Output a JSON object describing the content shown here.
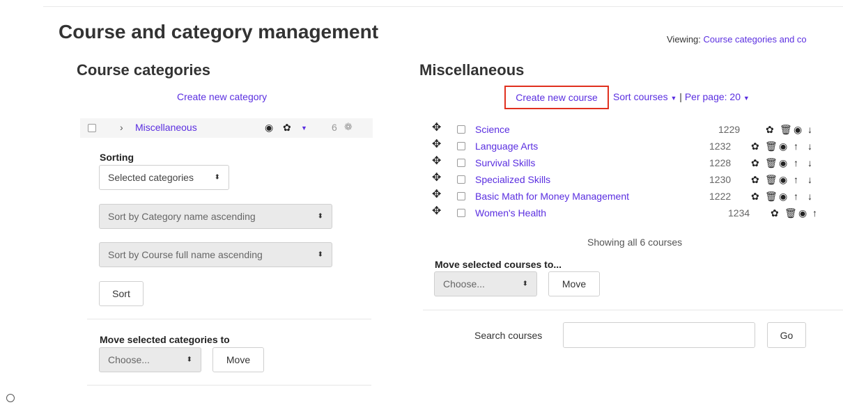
{
  "page": {
    "title": "Course and category management",
    "viewing_prefix": "Viewing: ",
    "viewing_link": "Course categories and co"
  },
  "categories": {
    "heading": "Course categories",
    "create_link": "Create new category",
    "row": {
      "name": "Miscellaneous",
      "count": "6"
    },
    "sorting": {
      "label": "Sorting",
      "scope_select": "Selected categories",
      "category_sort_select": "Sort by Category name ascending",
      "course_sort_select": "Sort by Course full name ascending",
      "sort_button": "Sort"
    },
    "move": {
      "label": "Move selected categories to",
      "select": "Choose...",
      "button": "Move"
    }
  },
  "courses": {
    "heading": "Miscellaneous",
    "create_link": "Create new course",
    "sort_link": "Sort courses",
    "separator": "|",
    "per_page": "Per page: 20",
    "list": [
      {
        "name": "Science",
        "id": "1229"
      },
      {
        "name": "Language Arts",
        "id": "1232"
      },
      {
        "name": "Survival Skills",
        "id": "1228"
      },
      {
        "name": "Specialized Skills",
        "id": "1230"
      },
      {
        "name": "Basic Math for Money Management",
        "id": "1222"
      },
      {
        "name": "Women's Health",
        "id": "1234"
      }
    ],
    "showing": "Showing all 6 courses",
    "move": {
      "label": "Move selected courses to...",
      "select": "Choose...",
      "button": "Move"
    },
    "search": {
      "label": "Search courses",
      "value": "",
      "button": "Go"
    }
  },
  "icons": {
    "eye": "eye-icon",
    "gear": "gear-icon",
    "trash": "trash-icon",
    "arrow_up": "arrow-up-icon",
    "arrow_down": "arrow-down-icon",
    "move": "move-icon"
  },
  "colors": {
    "link": "#5a2ee0",
    "highlight": "#e0301e"
  }
}
